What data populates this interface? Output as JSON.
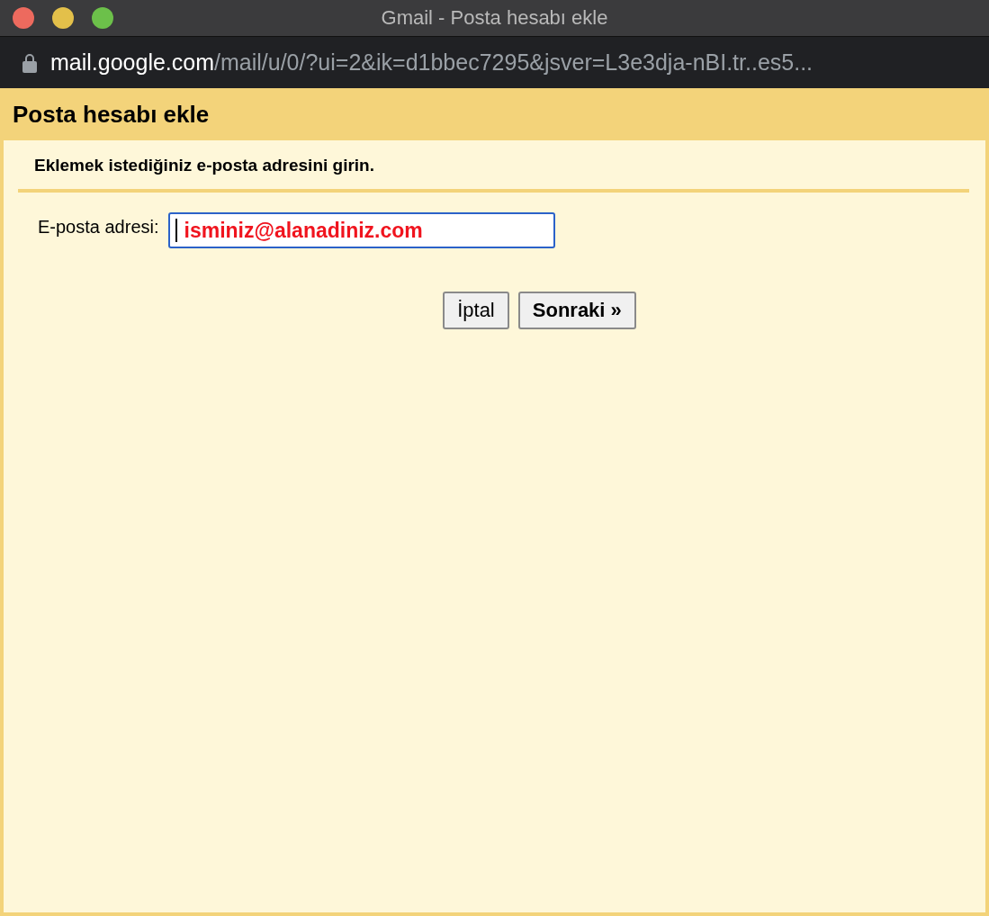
{
  "window": {
    "title": "Gmail - Posta hesabı ekle"
  },
  "address_bar": {
    "domain": "mail.google.com",
    "path": "/mail/u/0/?ui=2&ik=d1bbec7295&jsver=L3e3dja-nBI.tr..es5..."
  },
  "dialog": {
    "title": "Posta hesabı ekle",
    "instruction": "Eklemek istediğiniz e-posta adresini girin.",
    "email_field": {
      "label": "E-posta adresi:",
      "value": "isminiz@alanadiniz.com",
      "focused": true
    },
    "buttons": [
      {
        "label": "İptal",
        "primary": false
      },
      {
        "label": "Sonraki »",
        "primary": true
      }
    ]
  }
}
